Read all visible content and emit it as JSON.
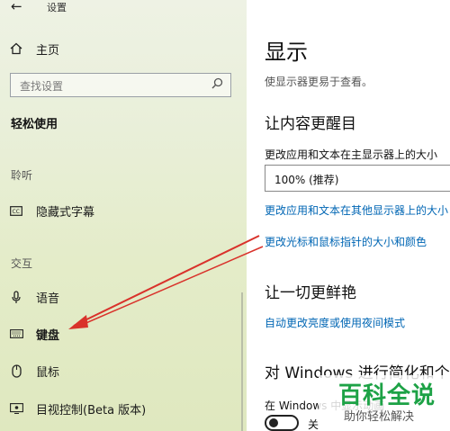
{
  "window": {
    "back_glyph": "←",
    "title": "设置"
  },
  "sidebar": {
    "home_label": "主页",
    "search_placeholder": "查找设置",
    "section_title": "轻松使用",
    "groups": [
      {
        "title": "聆听",
        "items": [
          {
            "label": "隐藏式字幕",
            "icon": "closed-caption-icon"
          }
        ]
      },
      {
        "title": "交互",
        "items": [
          {
            "label": "语音",
            "icon": "microphone-icon"
          },
          {
            "label": "键盘",
            "icon": "keyboard-icon"
          },
          {
            "label": "鼠标",
            "icon": "mouse-icon"
          },
          {
            "label": "目视控制(Beta 版本)",
            "icon": "eye-control-icon"
          }
        ]
      }
    ]
  },
  "main": {
    "title": "显示",
    "description": "使显示器更易于查看。",
    "section1": {
      "heading": "让内容更醒目",
      "label": "更改应用和文本在主显示器上的大小",
      "combo_value": "100% (推荐)",
      "link1": "更改应用和文本在其他显示器上的大小",
      "link2": "更改光标和鼠标指针的大小和颜色"
    },
    "section2": {
      "heading": "让一切更鲜艳",
      "link": "自动更改亮度或使用夜间模式"
    },
    "section3": {
      "heading": "对 Windows 进行简化和个性化",
      "label": "在 Windows 中显示动画",
      "toggle_state": "关"
    }
  },
  "watermark": {
    "line1": "百科全说",
    "line2": "助你轻松解决"
  },
  "colors": {
    "link": "#0066b4",
    "annotation_arrow": "#d9322b",
    "watermark_green": "#1da246"
  }
}
